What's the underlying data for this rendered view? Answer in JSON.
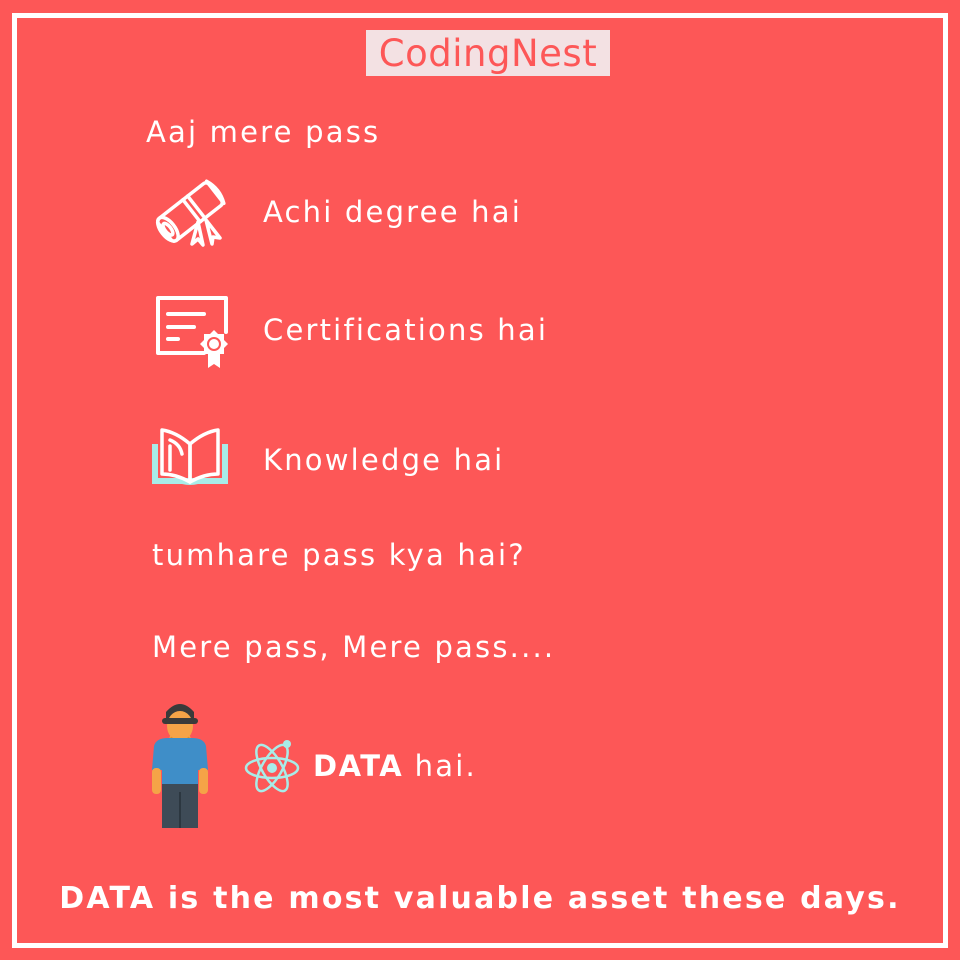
{
  "brand": {
    "logo_text": "CodingNest"
  },
  "colors": {
    "background": "#fd5757",
    "text": "#ffffff",
    "logo_box": "#f3e1e3",
    "book_accent": "#a8ece8"
  },
  "intro": "Aaj mere pass",
  "items": [
    {
      "icon": "diploma-scroll-icon",
      "label": "Achi degree hai"
    },
    {
      "icon": "certificate-icon",
      "label": "Certifications hai"
    },
    {
      "icon": "open-book-icon",
      "label": "Knowledge hai"
    }
  ],
  "question": "tumhare pass kya hai?",
  "reply": "Mere pass, Mere pass....",
  "answer": {
    "person_icon": "person-icon",
    "atom_icon": "atom-icon",
    "strong": "DATA",
    "rest": "hai."
  },
  "footer": "DATA is the most valuable asset these days."
}
